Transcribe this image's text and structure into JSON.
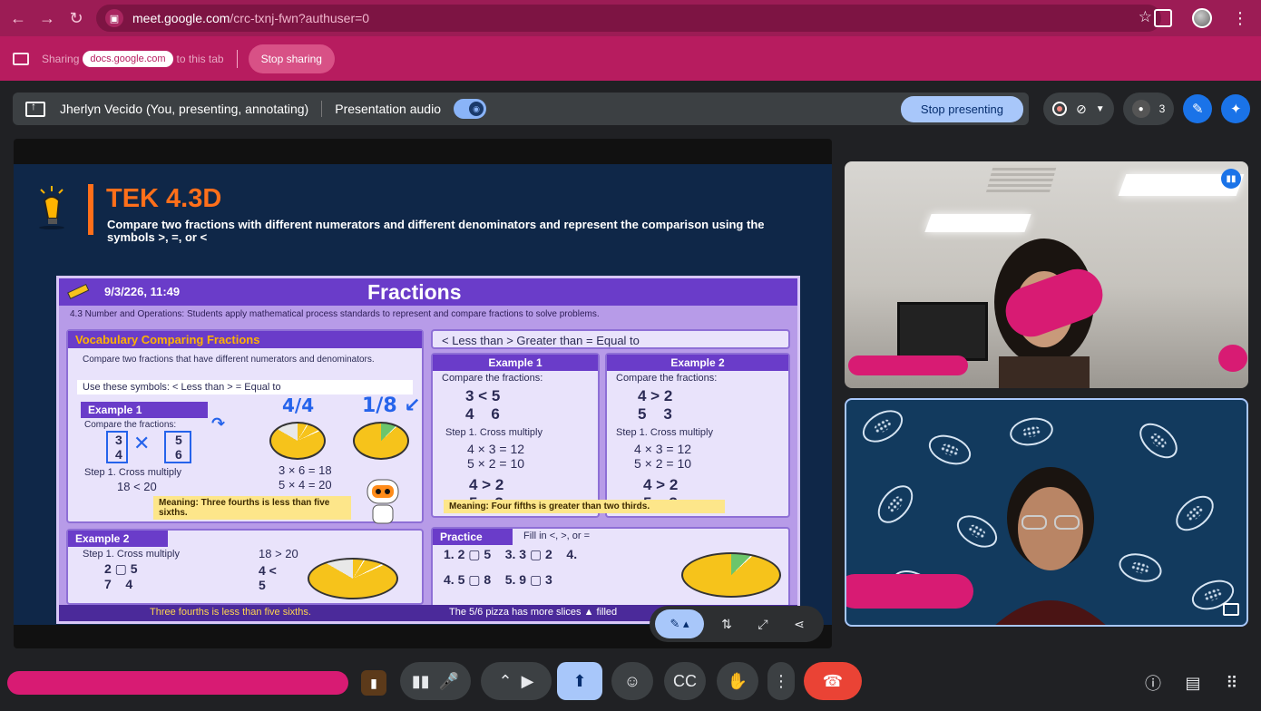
{
  "browser": {
    "url_host": "meet.google.com",
    "url_path": "/crc-txnj-fwn?authuser=0"
  },
  "share_bar": {
    "prefix": "Sharing",
    "domain": "docs.google.com",
    "suffix": "to this tab",
    "stop_label": "Stop sharing"
  },
  "present_bar": {
    "presenter": "Jherlyn Vecido (You, presenting, annotating)",
    "audio_label": "Presentation audio",
    "stop_label": "Stop presenting",
    "people_count": "3"
  },
  "slide": {
    "title": "TEK 4.3D",
    "description": "Compare two fractions with different numerators and different denominators and represent the comparison using the symbols >, =, or <",
    "poster": {
      "date": "9/3/226, 11:49",
      "title": "Fractions",
      "standard": "4.3 Number and Operations: Students apply mathematical process standards to represent and compare fractions to solve problems.",
      "vocab_head": "Vocabulary  Comparing Fractions",
      "vocab_text": "Compare two fractions that have different numerators and denominators.",
      "symbols_text": "Use these symbols:  < Less than  > = Equal to",
      "ex1_head": "Example 1",
      "ex1_compare": "Compare the fractions:",
      "ex1_step": "Step 1. Cross multiply",
      "ex1_calc1": "3 × 6 = 18",
      "ex1_calc2": "5 × 4 = 20",
      "ex1_result": "18 < 20",
      "ex1_meaning": "Meaning: Three fourths is less than five sixths.",
      "ex2_head": "Example 2",
      "ex2_step": "Step 1. Cross multiply",
      "ex2_result": "18 > 20",
      "footer_left": "Three fourths is less than five sixths.",
      "legend": "< Less than   > Greater than   = Equal to",
      "r_ex1_head": "Example 1",
      "r_ex1_compare": "Compare the fractions:",
      "r_ex1_step": "Step 1. Cross multiply",
      "r_ex1_calc1": "4 × 3 = 12",
      "r_ex1_calc2": "5 × 2 = 10",
      "r_ex2_head": "Example 2",
      "r_ex2_compare": "Compare the fractions:",
      "r_ex2_step": "Step 1. Cross multiply",
      "r_ex2_calc1": "4 × 3 = 12",
      "r_ex2_calc2": "5 × 2 = 10",
      "r_meaning": "Meaning: Four fifths is greater than two thirds.",
      "practice_head": "Practice",
      "practice_hint": "Fill in <, >, or =",
      "footer_right": "The 5/6 pizza has more slices ▲ filled"
    }
  },
  "colors": {
    "browser_bar": "#9c1c55",
    "share_bar": "#b71c5f",
    "accent_blue": "#a8c7fa",
    "end_call_red": "#ea4335",
    "tek_orange": "#ff6f1a"
  }
}
